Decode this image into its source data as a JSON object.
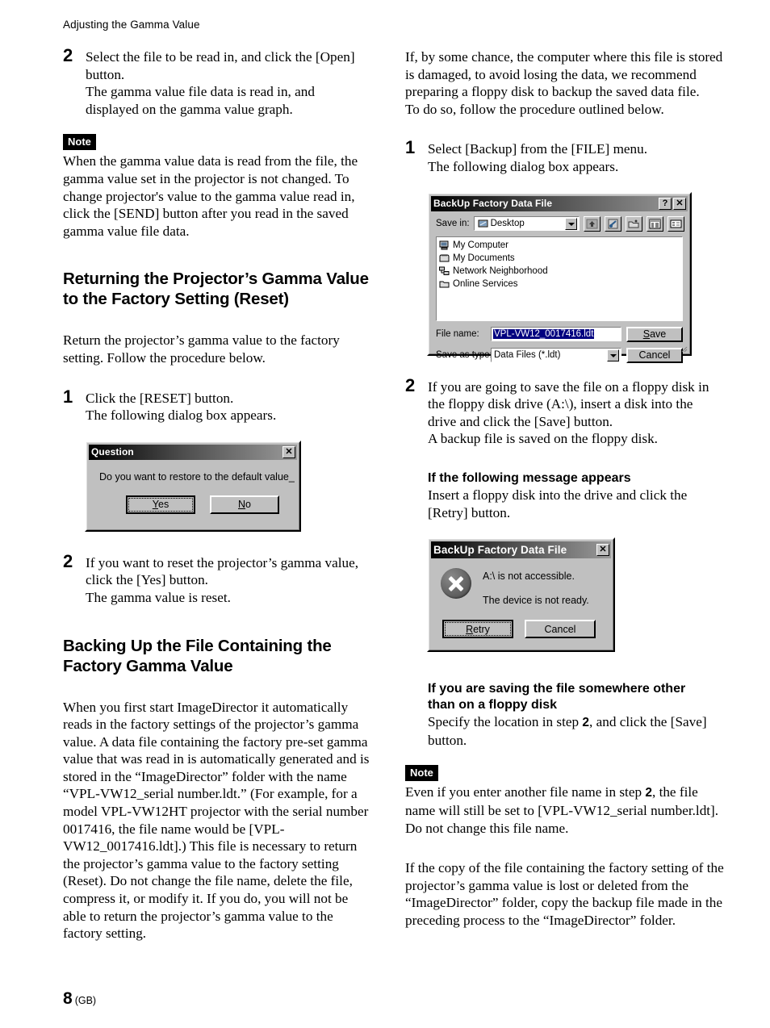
{
  "page": {
    "running_head": "Adjusting the Gamma Value",
    "number": "8",
    "region": "(GB)"
  },
  "left_column": {
    "step2": {
      "number": "2",
      "line1": "Select the file to be read in, and click the [Open]",
      "line2": "button.",
      "line3": "The gamma value file data is read in, and",
      "line4": "displayed on the gamma value graph."
    },
    "note1": {
      "tag": "Note",
      "text": "When the gamma value data is read from the file, the gamma value set in the projector is not changed. To change projector's value to the gamma value read in, click the [SEND] button after you read in the saved gamma value file data."
    },
    "heading_reset": "Returning the Projector’s Gamma Value to the Factory Setting (Reset)",
    "intro_reset": "Return the projector’s gamma value to the factory setting. Follow the procedure below.",
    "step1": {
      "number": "1",
      "line1": "Click the [RESET] button.",
      "line2": "The following dialog box appears."
    },
    "question_dialog": {
      "title": "Question",
      "close_label": "✕",
      "message": "Do you want to restore to the default value_",
      "yes_label": "Yes",
      "yes_accel": "Y",
      "no_label": "No",
      "no_accel": "N"
    },
    "step2b": {
      "number": "2",
      "line1": "If you want to reset the projector’s gamma value,",
      "line2": "click the [Yes] button.",
      "line3": "The gamma value is reset."
    },
    "heading_backup": "Backing Up the File Containing the Factory Gamma Value",
    "backup_para": "When you first start ImageDirector it automatically reads in the factory settings of the projector’s gamma value. A data file containing the factory pre-set gamma value that was read in is automatically generated and is stored in the “ImageDirector” folder with the name “VPL-VW12_serial number.ldt.” (For example, for a model VPL-VW12HT projector with the serial number 0017416, the file name would be [VPL-VW12_0017416.ldt].) This file is necessary to return the projector’s gamma value to the factory setting (Reset). Do not change the file name, delete the file, compress it, or modify it. If you do, you will not be able to return the projector’s gamma value to the factory setting."
  },
  "right_column": {
    "intro_para": "If, by some chance, the computer where this file is stored is damaged, to avoid losing the data, we recommend preparing a floppy disk to backup the saved data file.",
    "intro_para2": "To do so, follow the procedure outlined below.",
    "step1": {
      "number": "1",
      "line1": "Select [Backup] from the [FILE] menu.",
      "line2": "The following dialog box appears."
    },
    "save_dialog": {
      "title": "BackUp Factory Data File",
      "help_label": "?",
      "close_label": "✕",
      "save_in_label": "Save in:",
      "save_in_value": "Desktop",
      "items": [
        {
          "label": "My Computer",
          "icon": "computer-icon"
        },
        {
          "label": "My Documents",
          "icon": "documents-folder-icon"
        },
        {
          "label": "Network Neighborhood",
          "icon": "network-icon"
        },
        {
          "label": "Online Services",
          "icon": "folder-icon"
        }
      ],
      "toolbar_icons": [
        "up-one-level-icon",
        "go-to-last-folder-icon",
        "create-new-folder-icon",
        "list-view-icon",
        "details-view-icon"
      ],
      "file_name_label": "File name:",
      "file_name_value": "VPL-VW12_0017416.ldt",
      "save_as_type_label": "Save as type:",
      "save_as_type_value": "Data Files (*.ldt)",
      "save_button": "Save",
      "save_accel": "S",
      "cancel_button": "Cancel"
    },
    "step2": {
      "number": "2",
      "line1": "If you are going to save the file on a floppy disk in",
      "line2": "the floppy disk drive (A:\\), insert a disk into the",
      "line3": "drive and click the [Save] button.",
      "line4": "A backup file is saved on the floppy disk."
    },
    "msg_heading": "If the following message appears",
    "msg_text": "Insert a floppy disk into the drive and click the [Retry] button.",
    "error_dialog": {
      "title": "BackUp Factory Data File",
      "close_label": "✕",
      "icon": "error-x-icon",
      "line1": "A:\\ is not accessible.",
      "line2": "The device is not ready.",
      "retry_button": "Retry",
      "retry_accel": "R",
      "cancel_button": "Cancel"
    },
    "other_heading_l1": "If you are saving the file somewhere other",
    "other_heading_l2": "than on a floppy disk",
    "other_text_a": "Specify the location in step ",
    "other_text_step": "2",
    "other_text_b": ", and click the [Save] button.",
    "note2": {
      "tag": "Note",
      "text_a": "Even if you enter another file name in step ",
      "text_step": "2",
      "text_b": ", the file name will still be set to [VPL-VW12_serial number.ldt]. Do not change this file name."
    },
    "closing_para": "If the copy of the file containing the factory setting of the projector’s gamma value is lost or deleted from the “ImageDirector” folder, copy the backup file made in the preceding process to the “ImageDirector” folder."
  }
}
